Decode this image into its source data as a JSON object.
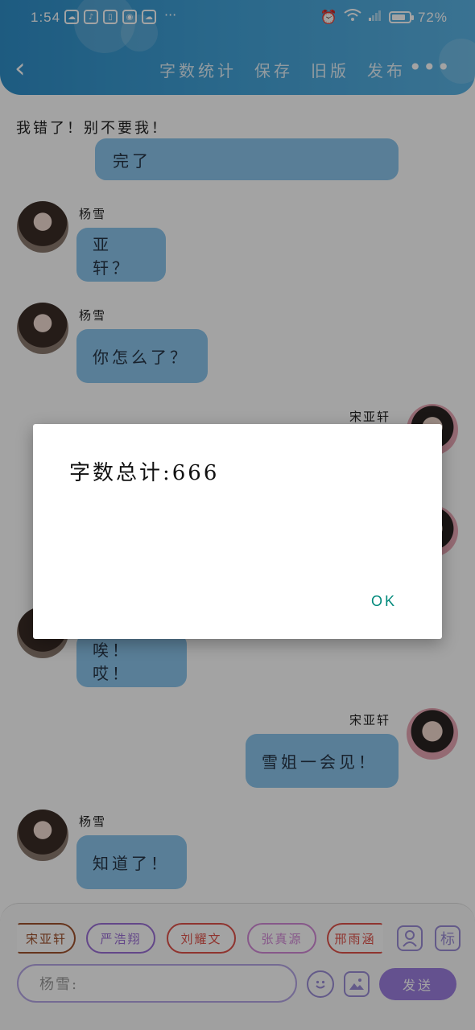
{
  "status_bar": {
    "time": "1:54",
    "app_icons": [
      "weather-icon",
      "music-icon",
      "book-icon",
      "bulb-icon",
      "cloud-icon"
    ],
    "more": "···",
    "battery_text": "72%",
    "battery_level": 0.72
  },
  "header": {
    "nav": [
      "字数统计",
      "保存",
      "旧版",
      "发布"
    ],
    "more": "•••"
  },
  "chat": {
    "top_note": "我错了！别不要我！",
    "partial_bubble": "完了",
    "messages": [
      {
        "sender": "杨雪",
        "text": "亚轩？"
      },
      {
        "sender": "杨雪",
        "text": "你怎么了？"
      },
      {
        "sender": "宋亚轩",
        "text": ""
      },
      {
        "sender": "",
        "text": "唉！ 哎！"
      },
      {
        "sender": "宋亚轩",
        "text": "雪姐一会见！"
      },
      {
        "sender": "杨雪",
        "text": "知道了！"
      }
    ]
  },
  "bottom": {
    "chips": [
      {
        "label": "宋亚轩",
        "color": "#a0522d"
      },
      {
        "label": "严浩翔",
        "color": "#9c6fd6"
      },
      {
        "label": "刘耀文",
        "color": "#e0524a"
      },
      {
        "label": "张真源",
        "color": "#d38ad8"
      },
      {
        "label": "邢雨涵",
        "color": "#e0524a"
      }
    ],
    "mark_button": "标",
    "input_placeholder": "杨雪:",
    "send_label": "发送"
  },
  "dialog": {
    "message": "字数总计:666",
    "ok_label": "OK"
  },
  "colors": {
    "header": "#3b9bd3",
    "bubble": "#8bc6ec",
    "accent": "#9d7fe0",
    "ok": "#00897b"
  }
}
